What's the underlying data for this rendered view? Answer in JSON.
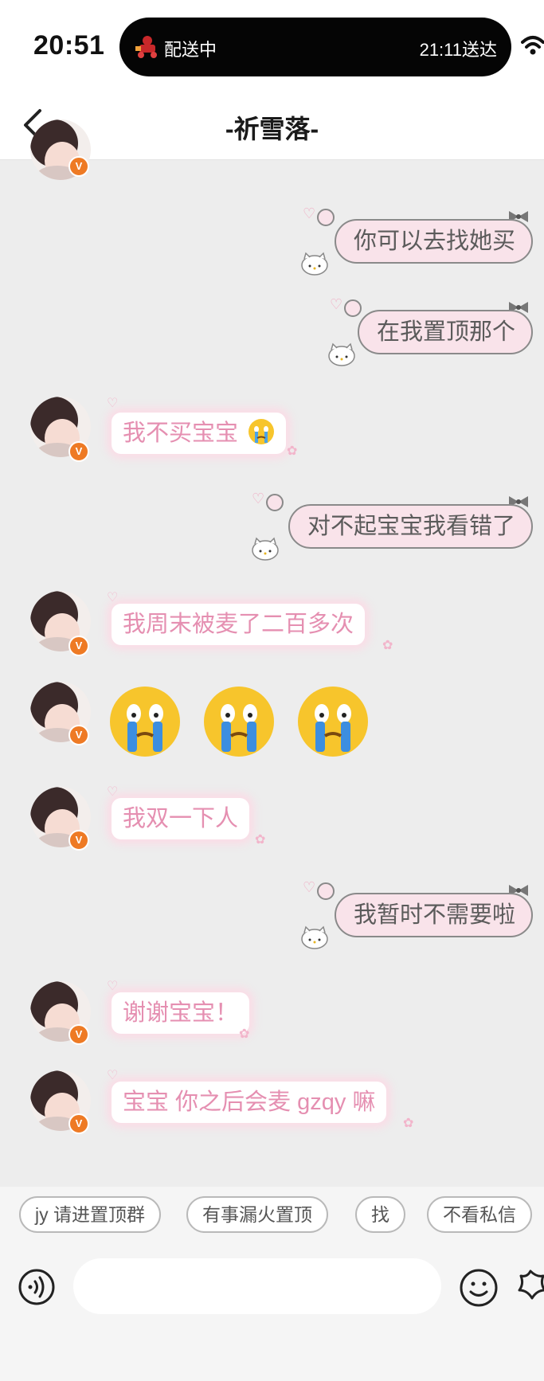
{
  "status_bar": {
    "time": "20:51",
    "island_status": "配送中",
    "island_eta": "21:11送达"
  },
  "nav": {
    "title": "-祈雪落-"
  },
  "messages": [
    {
      "side": "out",
      "text": "你可以去找她买"
    },
    {
      "side": "out",
      "text": "在我置顶那个"
    },
    {
      "side": "in",
      "text": "我不买宝宝"
    },
    {
      "side": "out",
      "text": "对不起宝宝我看错了"
    },
    {
      "side": "in",
      "text": "我周末被麦了二百多次"
    },
    {
      "side": "in",
      "type": "emoji",
      "count": 3,
      "emoji": "crying-face"
    },
    {
      "side": "in",
      "text": "我双一下人"
    },
    {
      "side": "out",
      "text": "我暂时不需要啦"
    },
    {
      "side": "in",
      "text": "谢谢宝宝！"
    },
    {
      "side": "in",
      "text": "宝宝 你之后会麦 gzqy 嘛"
    }
  ],
  "quick_replies": [
    "jy 请进置顶群",
    "有事漏火置顶",
    "找",
    "不看私信"
  ],
  "input": {
    "placeholder": ""
  },
  "colors": {
    "incoming_text": "#e58fb1",
    "outgoing_bubble": "#f9e3ea",
    "badge": "#ee7a24",
    "background": "#ededed"
  }
}
